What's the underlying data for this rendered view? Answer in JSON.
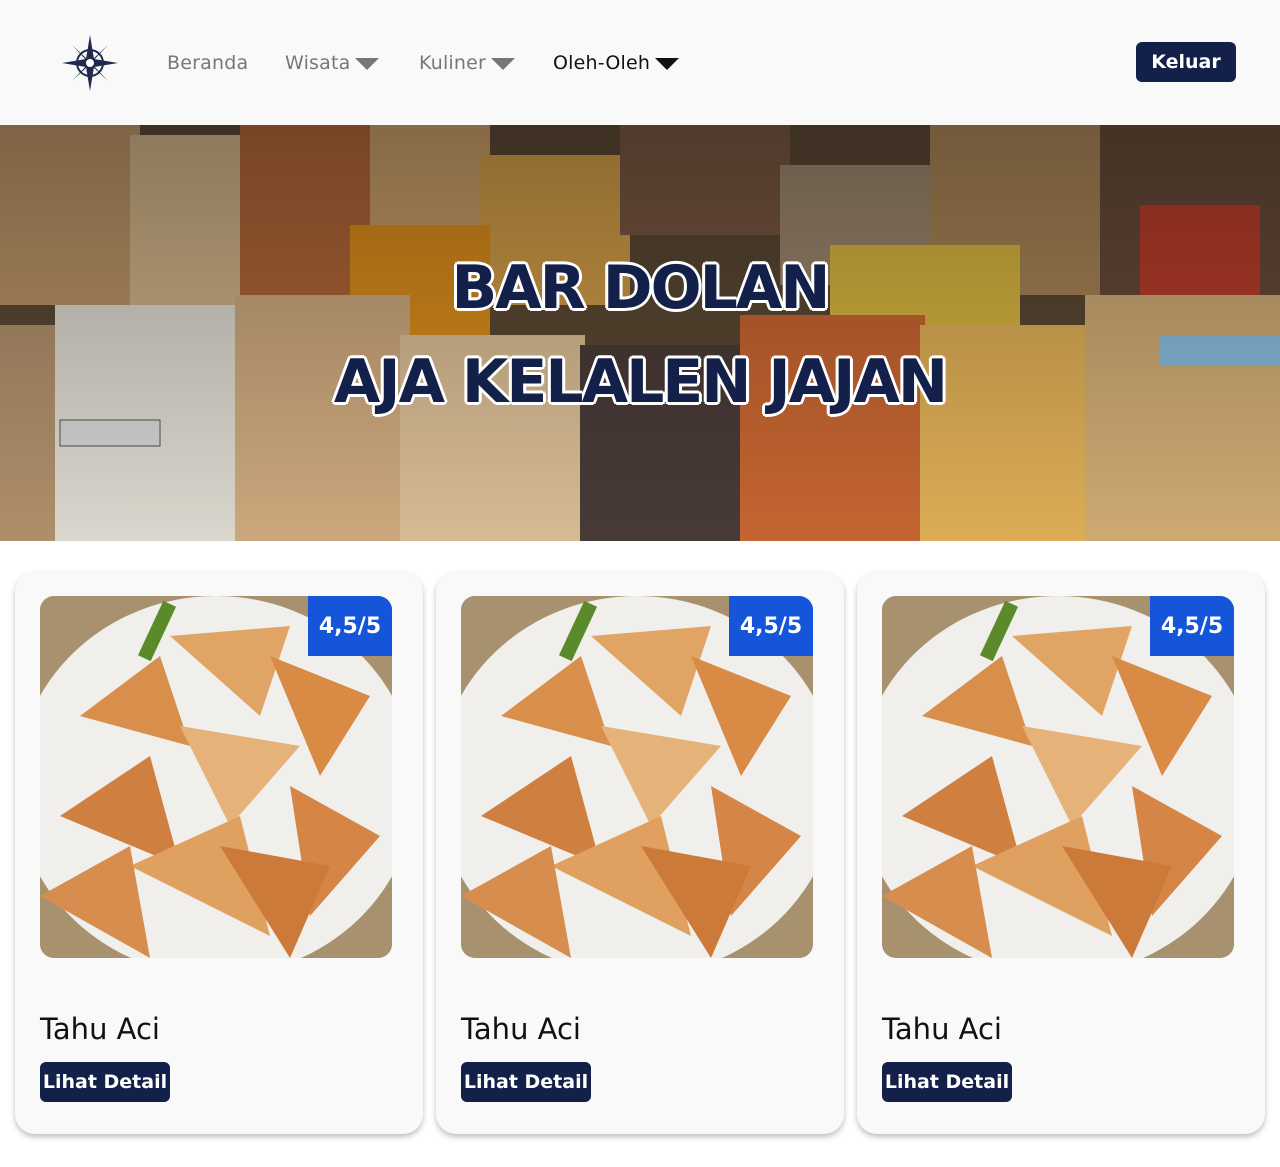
{
  "nav": {
    "items": [
      {
        "label": "Beranda",
        "has_dropdown": false,
        "active": false
      },
      {
        "label": "Wisata",
        "has_dropdown": true,
        "active": false
      },
      {
        "label": "Kuliner",
        "has_dropdown": true,
        "active": false
      },
      {
        "label": "Oleh-Oleh",
        "has_dropdown": true,
        "active": true
      }
    ],
    "logout_label": "Keluar",
    "logo_icon": "compass-rose-icon"
  },
  "hero": {
    "line1": "BAR DOLAN",
    "line2": "AJA KELALEN JAJAN"
  },
  "cards": [
    {
      "title": "Tahu Aci",
      "rating": "4,5/5",
      "button_label": "Lihat Detail"
    },
    {
      "title": "Tahu Aci",
      "rating": "4,5/5",
      "button_label": "Lihat Detail"
    },
    {
      "title": "Tahu Aci",
      "rating": "4,5/5",
      "button_label": "Lihat Detail"
    }
  ],
  "colors": {
    "brand_navy": "#132049",
    "rating_blue": "#1555d9",
    "nav_bg": "#f9f9f9",
    "nav_inactive": "#777777",
    "nav_active": "#111111"
  }
}
